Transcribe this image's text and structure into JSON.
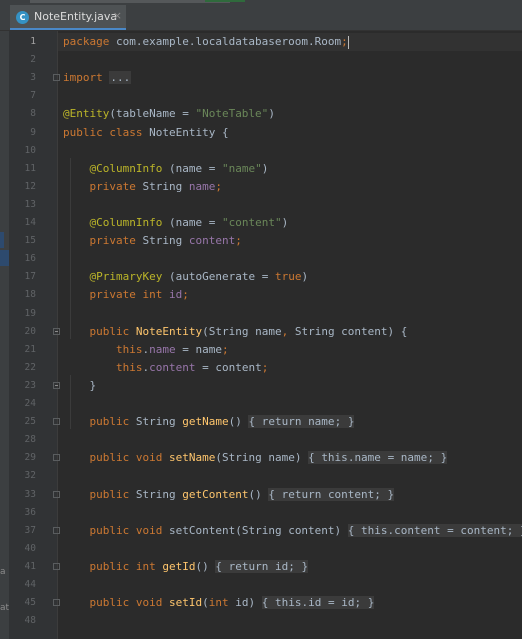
{
  "tab": {
    "title": "NoteEntity.java",
    "icon_letter": "C",
    "close": "×"
  },
  "left_edge": {
    "frag1": "a",
    "frag2": "at"
  },
  "lines": [
    {
      "n": "1",
      "current": true,
      "segs": [
        [
          "k",
          "package "
        ],
        [
          "",
          "com.example.localdatabaseroom.Room"
        ],
        [
          "k",
          ";"
        ]
      ],
      "caret": true
    },
    {
      "n": "2",
      "segs": []
    },
    {
      "n": "3",
      "segs": [
        [
          "k",
          "import "
        ],
        [
          "ell",
          "..."
        ]
      ],
      "fold": "plus"
    },
    {
      "n": "7",
      "segs": []
    },
    {
      "n": "8",
      "segs": [
        [
          "an",
          "@Entity"
        ],
        [
          "",
          "(tableName = "
        ],
        [
          "s",
          "\"NoteTable\""
        ],
        [
          "",
          ")"
        ]
      ]
    },
    {
      "n": "9",
      "segs": [
        [
          "k",
          "public class "
        ],
        [
          "",
          "NoteEntity {"
        ]
      ]
    },
    {
      "n": "10",
      "segs": []
    },
    {
      "n": "11",
      "segs": [
        [
          "",
          "    "
        ],
        [
          "an",
          "@ColumnInfo "
        ],
        [
          "",
          "(name = "
        ],
        [
          "s",
          "\"name\""
        ],
        [
          "",
          ")"
        ]
      ]
    },
    {
      "n": "12",
      "segs": [
        [
          "",
          "    "
        ],
        [
          "k",
          "private "
        ],
        [
          "",
          "String "
        ],
        [
          "f",
          "name"
        ],
        [
          "k",
          ";"
        ]
      ]
    },
    {
      "n": "13",
      "segs": []
    },
    {
      "n": "14",
      "segs": [
        [
          "",
          "    "
        ],
        [
          "an",
          "@ColumnInfo "
        ],
        [
          "",
          "(name = "
        ],
        [
          "s",
          "\"content\""
        ],
        [
          "",
          ")"
        ]
      ]
    },
    {
      "n": "15",
      "segs": [
        [
          "",
          "    "
        ],
        [
          "k",
          "private "
        ],
        [
          "",
          "String "
        ],
        [
          "f",
          "content"
        ],
        [
          "k",
          ";"
        ]
      ]
    },
    {
      "n": "16",
      "segs": []
    },
    {
      "n": "17",
      "segs": [
        [
          "",
          "    "
        ],
        [
          "an",
          "@PrimaryKey "
        ],
        [
          "",
          "(autoGenerate = "
        ],
        [
          "k",
          "true"
        ],
        [
          "",
          ")"
        ]
      ]
    },
    {
      "n": "18",
      "segs": [
        [
          "",
          "    "
        ],
        [
          "k",
          "private int "
        ],
        [
          "f",
          "id"
        ],
        [
          "k",
          ";"
        ]
      ]
    },
    {
      "n": "19",
      "segs": []
    },
    {
      "n": "20",
      "segs": [
        [
          "",
          "    "
        ],
        [
          "k",
          "public "
        ],
        [
          "m",
          "NoteEntity"
        ],
        [
          "",
          "(String name"
        ],
        [
          "k",
          ", "
        ],
        [
          "",
          "String content) {"
        ]
      ],
      "fold": "minus"
    },
    {
      "n": "21",
      "segs": [
        [
          "",
          "        "
        ],
        [
          "k",
          "this"
        ],
        [
          "",
          "."
        ],
        [
          "f",
          "name "
        ],
        [
          "",
          "= name"
        ],
        [
          "k",
          ";"
        ]
      ]
    },
    {
      "n": "22",
      "segs": [
        [
          "",
          "        "
        ],
        [
          "k",
          "this"
        ],
        [
          "",
          "."
        ],
        [
          "f",
          "content "
        ],
        [
          "",
          "= content"
        ],
        [
          "k",
          ";"
        ]
      ]
    },
    {
      "n": "23",
      "segs": [
        [
          "",
          "    }"
        ]
      ],
      "fold": "minus"
    },
    {
      "n": "24",
      "segs": []
    },
    {
      "n": "25",
      "segs": [
        [
          "",
          "    "
        ],
        [
          "k",
          "public "
        ],
        [
          "",
          "String "
        ],
        [
          "m",
          "getName"
        ],
        [
          "",
          "() "
        ],
        [
          "fold-box",
          "{ "
        ],
        [
          "fbk",
          "return "
        ],
        [
          "fbf",
          "name"
        ],
        [
          "fbk",
          "; "
        ],
        [
          "fold-box",
          "}"
        ]
      ],
      "fold": "plus"
    },
    {
      "n": "28",
      "segs": []
    },
    {
      "n": "29",
      "segs": [
        [
          "",
          "    "
        ],
        [
          "k",
          "public void "
        ],
        [
          "m",
          "setName"
        ],
        [
          "",
          "(String name) "
        ],
        [
          "fold-box",
          "{ "
        ],
        [
          "fbk",
          "this"
        ],
        [
          "fold-box",
          "."
        ],
        [
          "fbf",
          "name "
        ],
        [
          "fold-box",
          "= name"
        ],
        [
          "fbk",
          "; "
        ],
        [
          "fold-box",
          "}"
        ]
      ],
      "fold": "plus"
    },
    {
      "n": "32",
      "segs": []
    },
    {
      "n": "33",
      "segs": [
        [
          "",
          "    "
        ],
        [
          "k",
          "public "
        ],
        [
          "",
          "String "
        ],
        [
          "m",
          "getContent"
        ],
        [
          "",
          "() "
        ],
        [
          "fold-box",
          "{ "
        ],
        [
          "fbk",
          "return "
        ],
        [
          "fbf",
          "content"
        ],
        [
          "fbk",
          "; "
        ],
        [
          "fold-box",
          "}"
        ]
      ],
      "fold": "plus"
    },
    {
      "n": "36",
      "segs": []
    },
    {
      "n": "37",
      "segs": [
        [
          "",
          "    "
        ],
        [
          "k",
          "public void "
        ],
        [
          "",
          "setContent(String content) "
        ],
        [
          "fold-box",
          "{ "
        ],
        [
          "fbk",
          "this"
        ],
        [
          "fold-box",
          "."
        ],
        [
          "fbf",
          "content "
        ],
        [
          "fold-box",
          "= content"
        ],
        [
          "fbk",
          "; "
        ],
        [
          "fold-box",
          "}"
        ]
      ],
      "fold": "plus"
    },
    {
      "n": "40",
      "segs": []
    },
    {
      "n": "41",
      "segs": [
        [
          "",
          "    "
        ],
        [
          "k",
          "public int "
        ],
        [
          "m",
          "getId"
        ],
        [
          "",
          "() "
        ],
        [
          "fold-box",
          "{ "
        ],
        [
          "fbk",
          "return "
        ],
        [
          "fbf",
          "id"
        ],
        [
          "fbk",
          "; "
        ],
        [
          "fold-box",
          "}"
        ]
      ],
      "fold": "plus"
    },
    {
      "n": "44",
      "segs": []
    },
    {
      "n": "45",
      "segs": [
        [
          "",
          "    "
        ],
        [
          "k",
          "public void "
        ],
        [
          "m",
          "setId"
        ],
        [
          "",
          "("
        ],
        [
          "k",
          "int "
        ],
        [
          "",
          "id) "
        ],
        [
          "fold-box",
          "{ "
        ],
        [
          "fbk",
          "this"
        ],
        [
          "fold-box",
          "."
        ],
        [
          "fbf",
          "id "
        ],
        [
          "fold-box",
          "= id"
        ],
        [
          "fbk",
          "; "
        ],
        [
          "fold-box",
          "}"
        ]
      ],
      "fold": "plus"
    },
    {
      "n": "48",
      "segs": []
    }
  ]
}
